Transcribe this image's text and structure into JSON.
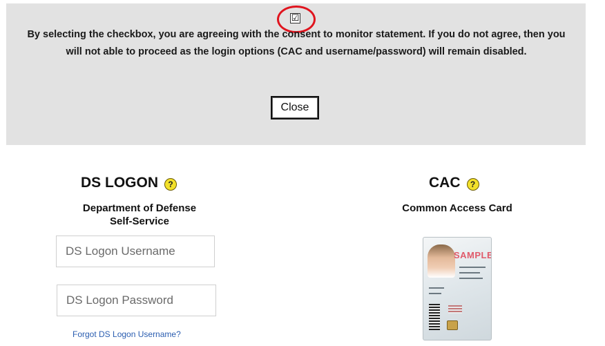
{
  "consent": {
    "checkbox_checked": true,
    "checkbox_glyph": "☑",
    "highlight_color": "#e0141e",
    "statement": "By selecting the checkbox, you are agreeing with the consent to monitor statement. If you do not agree, then you will not able to proceed as the login options (CAC and username/password) will remain disabled.",
    "close_label": "Close"
  },
  "ds_logon": {
    "title": "DS LOGON",
    "help_icon": "?",
    "subtitle_line1": "Department of Defense",
    "subtitle_line2": "Self-Service",
    "username_placeholder": "DS Logon Username",
    "password_placeholder": "DS Logon Password",
    "forgot_link": "Forgot DS Logon Username?"
  },
  "cac": {
    "title": "CAC",
    "help_icon": "?",
    "subtitle": "Common Access Card",
    "card_sample_text": "SAMPLE",
    "card_icon": "cac-card-image"
  },
  "colors": {
    "panel_bg": "#e2e2e2",
    "help_icon_bg": "#f3e12b",
    "link": "#2a5db0"
  }
}
